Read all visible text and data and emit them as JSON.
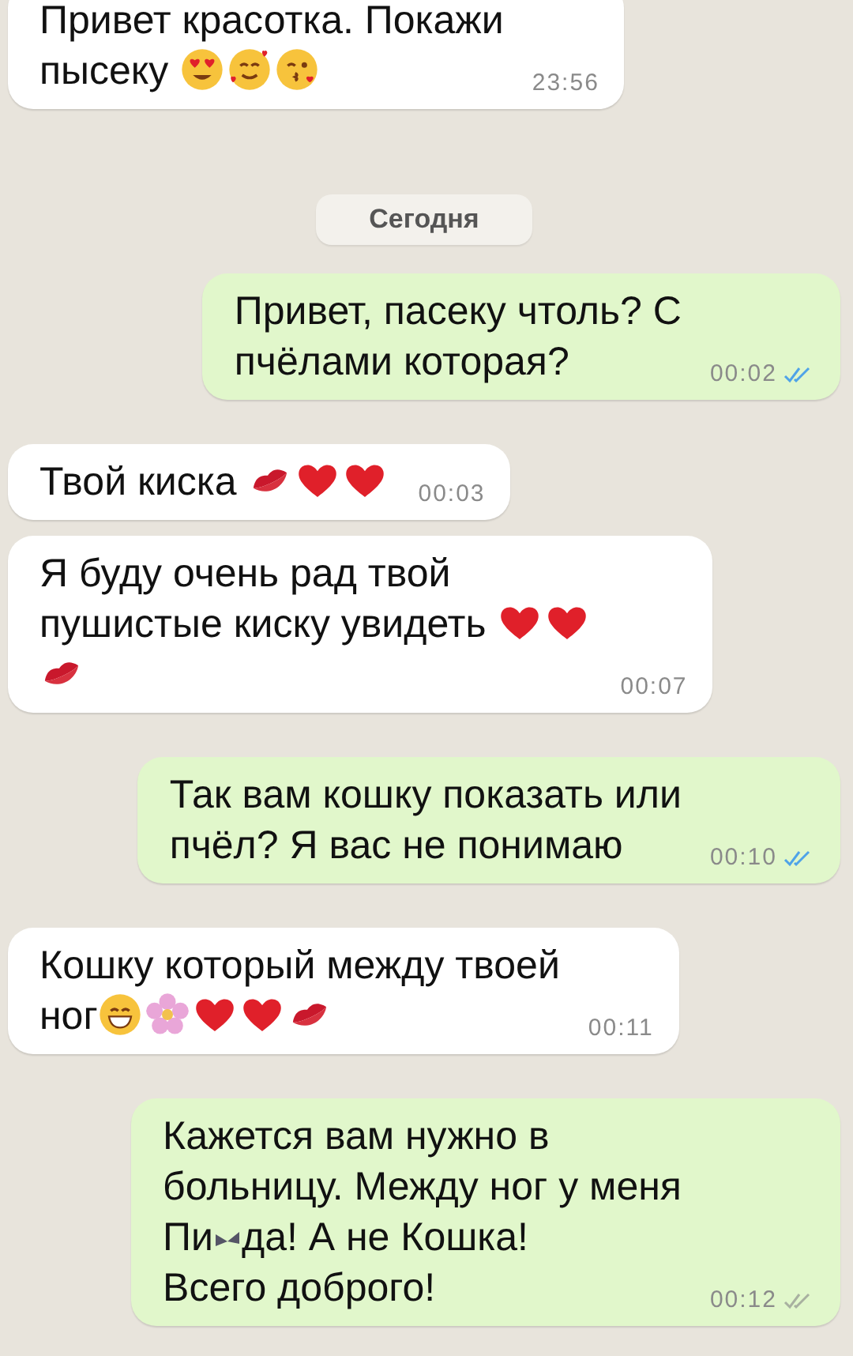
{
  "items": [
    {
      "kind": "incoming",
      "content": [
        {
          "kind": "text",
          "text": "Привет красотка. Покажи\nпысеку "
        },
        {
          "kind": "heart-eyes"
        },
        {
          "kind": "smiling-hearts"
        },
        {
          "kind": "kiss"
        }
      ],
      "time": "23:56"
    },
    {
      "kind": "date",
      "label": "Сегодня"
    },
    {
      "kind": "outgoing",
      "content": [
        {
          "kind": "text",
          "text": "Привет, пасеку чтоль? С\nпчёлами которая?"
        }
      ],
      "time": "00:02",
      "read": true
    },
    {
      "kind": "incoming",
      "content": [
        {
          "kind": "text",
          "text": "Твой киска "
        },
        {
          "kind": "lips"
        },
        {
          "kind": "heart"
        },
        {
          "kind": "heart"
        }
      ],
      "time": "00:03"
    },
    {
      "kind": "incoming",
      "content": [
        {
          "kind": "text",
          "text": "Я буду очень рад твой\nпушистые киску увидеть "
        },
        {
          "kind": "heart"
        },
        {
          "kind": "heart"
        },
        {
          "kind": "break"
        },
        {
          "kind": "lips"
        }
      ],
      "time": "00:07"
    },
    {
      "kind": "outgoing",
      "content": [
        {
          "kind": "text",
          "text": "Так вам кошку показать или\nпчёл? Я вас не понимаю"
        }
      ],
      "time": "00:10",
      "read": true
    },
    {
      "kind": "incoming",
      "content": [
        {
          "kind": "text",
          "text": "Кошку который между твоей\nног"
        },
        {
          "kind": "grin"
        },
        {
          "kind": "flower"
        },
        {
          "kind": "heart"
        },
        {
          "kind": "heart"
        },
        {
          "kind": "lips"
        }
      ],
      "time": "00:11"
    },
    {
      "kind": "outgoing",
      "content": [
        {
          "kind": "text",
          "text": "Кажется вам нужно в\nбольницу. Между ног у меня\nПи"
        },
        {
          "kind": "censor"
        },
        {
          "kind": "text",
          "text": "да! А не Кошка!\nВсего доброго!"
        }
      ],
      "time": "00:12",
      "read": false
    }
  ]
}
